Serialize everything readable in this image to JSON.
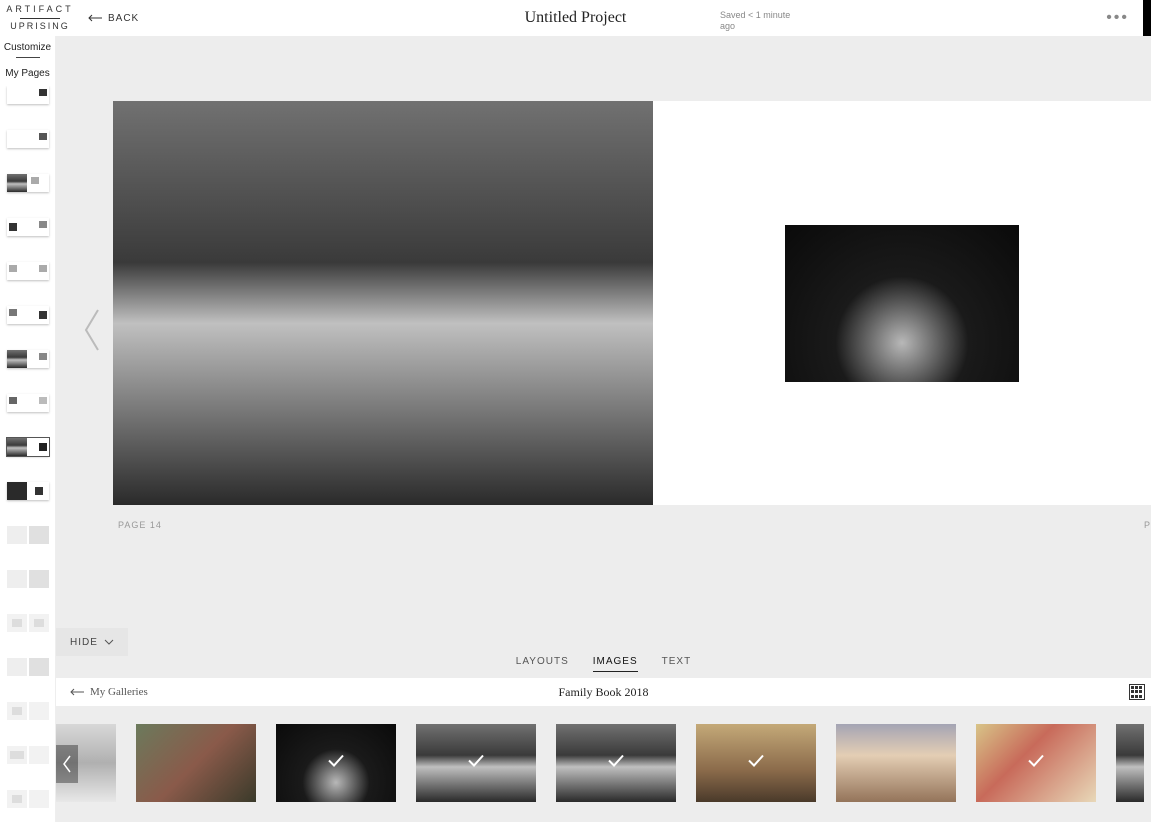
{
  "header": {
    "logo_line1": "ARTIFACT",
    "logo_line2": "UPRISING",
    "back_label": "BACK",
    "project_title": "Untitled Project",
    "saved_status": "Saved < 1 minute ago"
  },
  "sidebar": {
    "tab_customize": "Customize",
    "tab_pages": "My Pages"
  },
  "canvas": {
    "page_left_label": "PAGE 14",
    "page_right_label": "P"
  },
  "panel": {
    "hide_label": "HIDE",
    "tabs": {
      "layouts": "LAYOUTS",
      "images": "IMAGES",
      "text": "TEXT"
    },
    "gallery_back": "My Galleries",
    "gallery_title": "Family Book 2018"
  },
  "strip": {
    "items": [
      {
        "used": false,
        "style": "light-photo"
      },
      {
        "used": false,
        "style": "col-photo"
      },
      {
        "used": true,
        "style": "bw-photo2"
      },
      {
        "used": true,
        "style": "bw-photo1"
      },
      {
        "used": true,
        "style": "bw-photo1"
      },
      {
        "used": true,
        "style": "sepia-photo"
      },
      {
        "used": false,
        "style": "col-photo3"
      },
      {
        "used": true,
        "style": "col-photo2"
      },
      {
        "used": false,
        "style": "bw-photo1"
      }
    ]
  }
}
